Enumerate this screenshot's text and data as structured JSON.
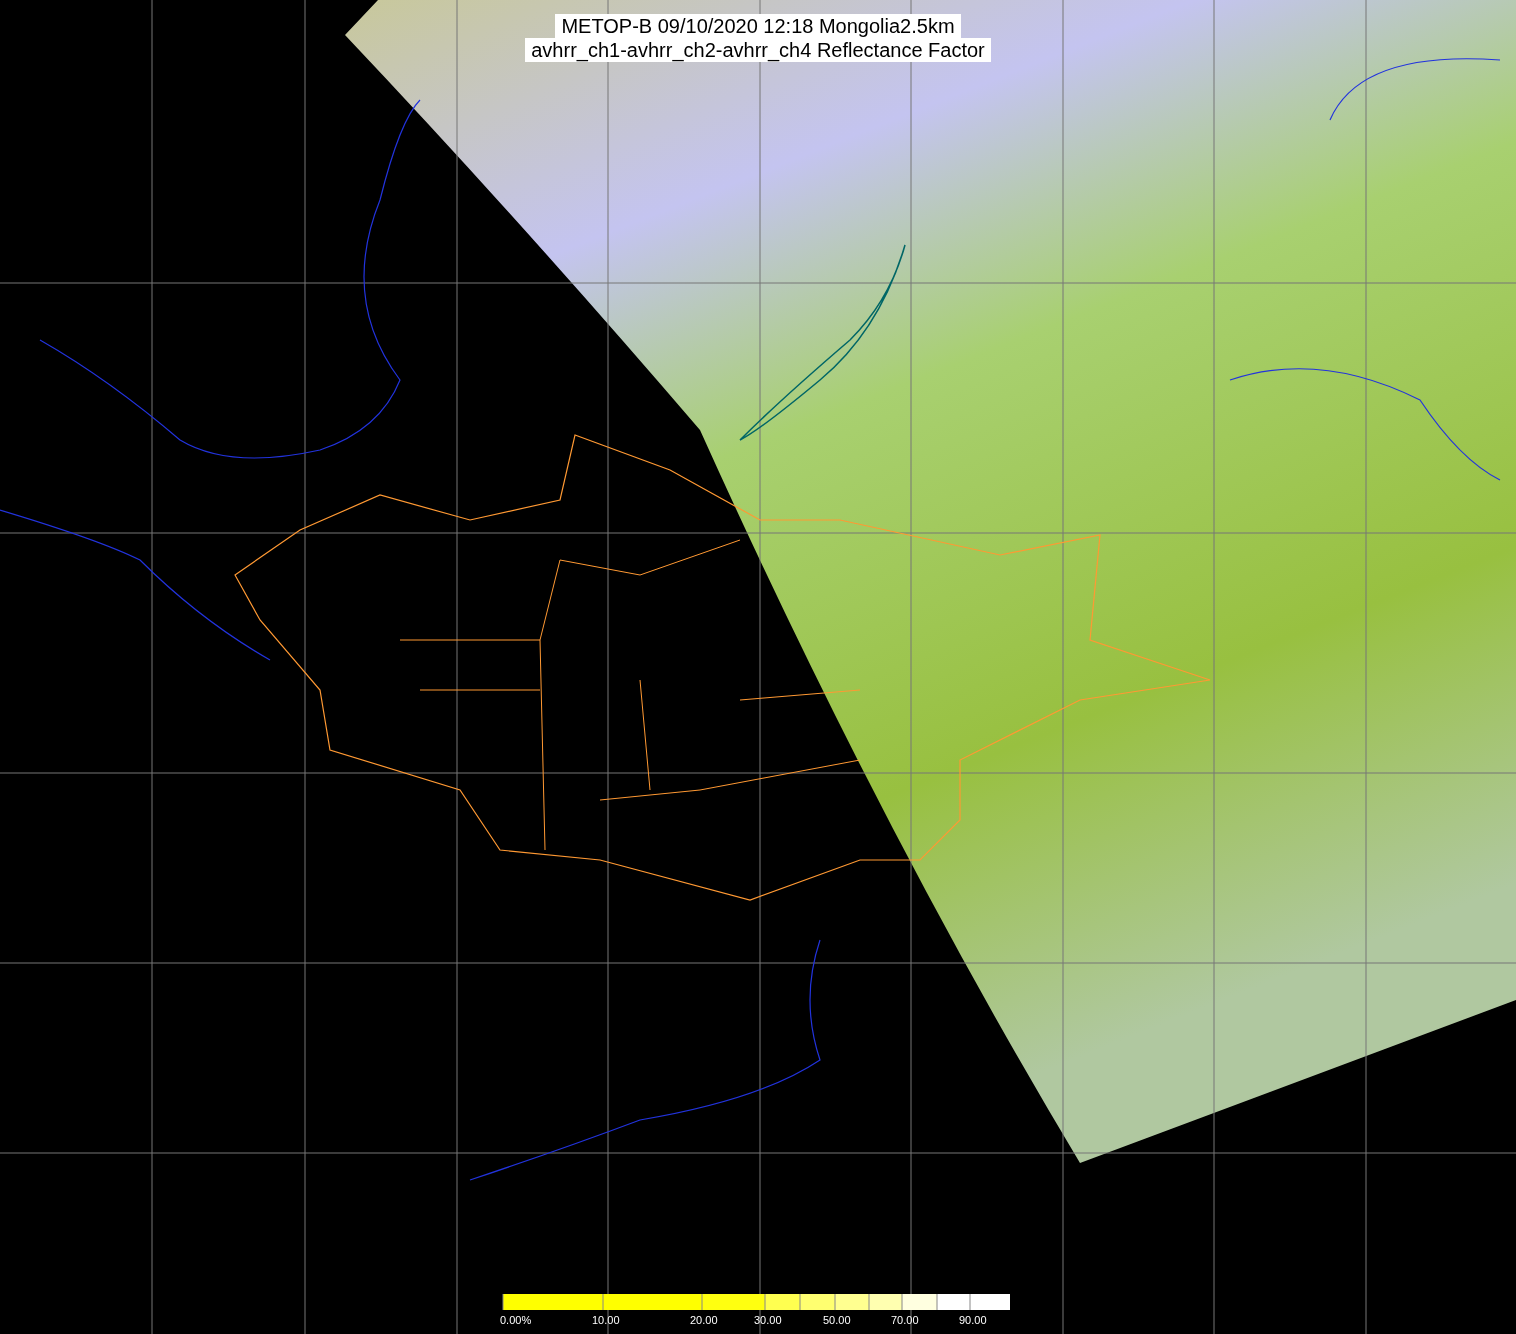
{
  "title": {
    "lines": [
      "METOP-B 09/10/2020 12:18 Mongolia2.5km",
      "avhrr_ch1-avhrr_ch2-avhrr_ch4 Reflectance Factor"
    ]
  },
  "colorbar": {
    "labels": [
      "0.00%",
      "10.00",
      "20.00",
      "30.00",
      "50.00",
      "70.00",
      "90.00"
    ]
  }
}
